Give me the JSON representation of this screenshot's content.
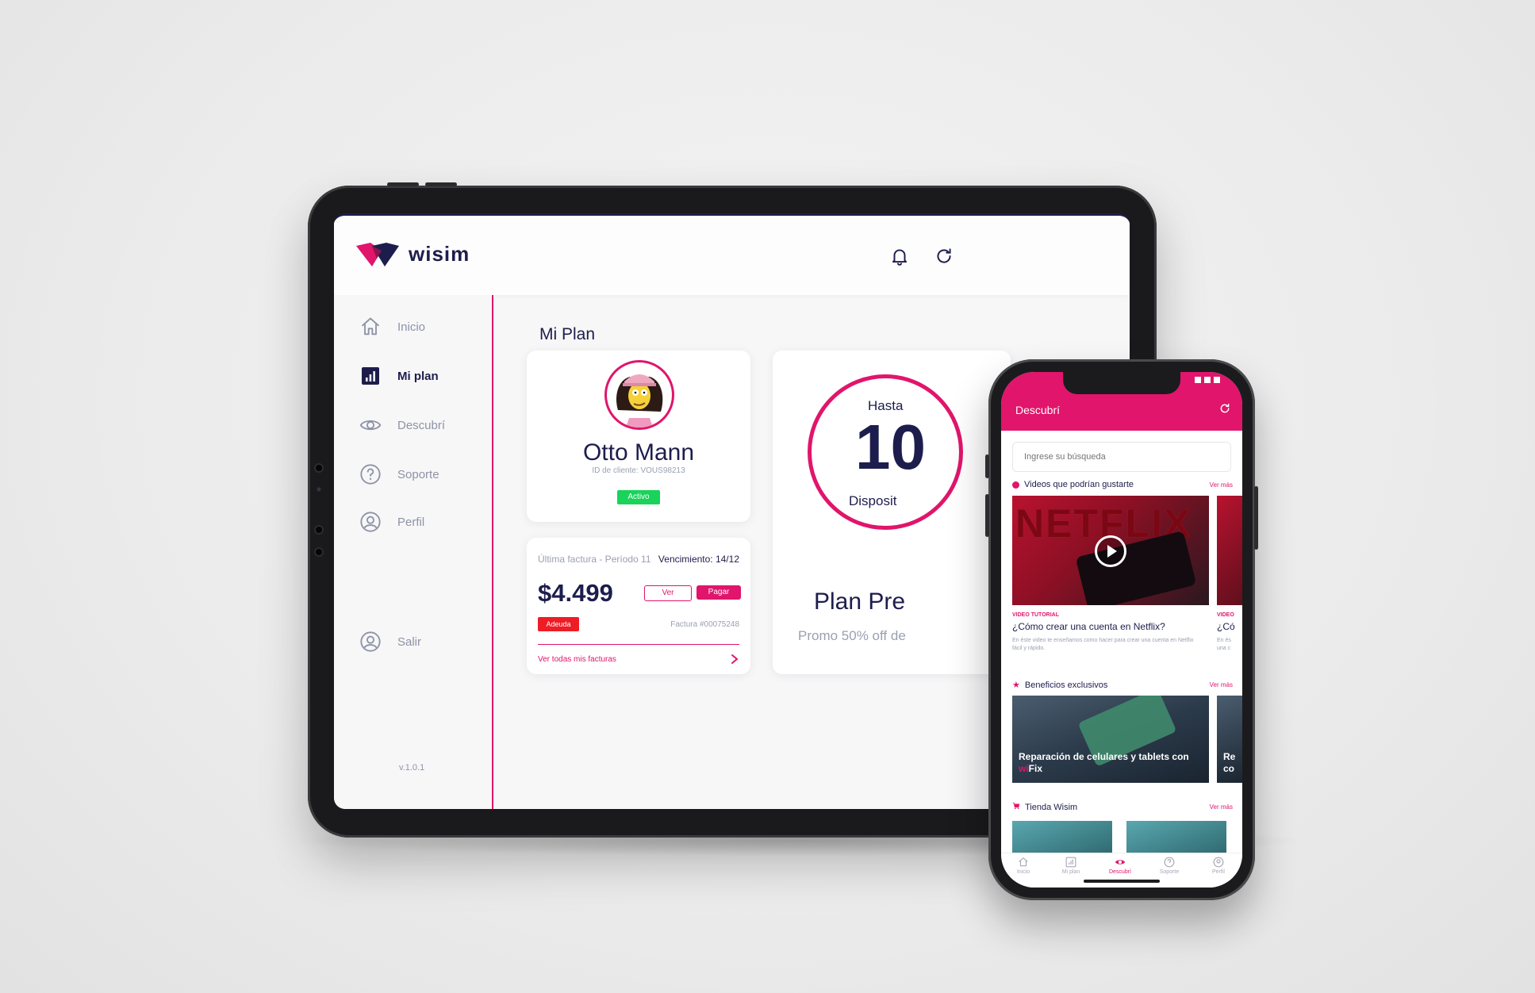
{
  "brand": {
    "name": "wisim",
    "accent": "#e0156b",
    "navy": "#1d1d4d"
  },
  "tablet": {
    "header": {
      "icons": [
        "bell-icon",
        "refresh-icon"
      ]
    },
    "sidebar": {
      "items": [
        {
          "label": "Inicio",
          "icon": "home-icon"
        },
        {
          "label": "Mi plan",
          "icon": "bar-chart-icon"
        },
        {
          "label": "Descubrí",
          "icon": "eye-icon"
        },
        {
          "label": "Soporte",
          "icon": "question-icon"
        },
        {
          "label": "Perfil",
          "icon": "user-icon"
        }
      ],
      "logout": "Salir",
      "version": "v.1.0.1"
    },
    "main": {
      "title": "Mi Plan",
      "profile": {
        "name": "Otto Mann",
        "client_id": "ID de cliente: VOUS98213",
        "status": "Activo"
      },
      "bill": {
        "period": "Última factura - Período 11",
        "due": "Vencimiento: 14/12",
        "amount": "$4.499",
        "view_label": "Ver",
        "pay_label": "Pagar",
        "status": "Adeuda",
        "invoice": "Factura #00075248",
        "all_link": "Ver todas mis facturas"
      },
      "plan": {
        "upto": "Hasta",
        "number": "10",
        "devices": "Disposit",
        "name": "Plan Pre",
        "promo": "Promo 50% off de"
      }
    }
  },
  "phone": {
    "title": "Descubrí",
    "search_placeholder": "Ingrese su búsqueda",
    "sections": {
      "videos": {
        "title": "Videos que podrían gustarte",
        "more": "Ver más"
      },
      "benefits": {
        "title": "Beneficios exclusivos",
        "more": "Ver más"
      },
      "shop": {
        "title": "Tienda Wisim",
        "more": "Ver más"
      }
    },
    "video": {
      "thumb_text": "NETFLIX",
      "tag": "VIDEO TUTORIAL",
      "title": "¿Cómo crear una cuenta en Netflix?",
      "desc": "En éste video te enseñamos como hacer para crear una cuenta en Netflix fácil y rápido.",
      "tag2": "VIDEO",
      "title2": "¿Có",
      "desc2": "En és una c"
    },
    "benefit": {
      "title_part1": "Reparación de celulares y tablets con",
      "brand_part1": "wi",
      "brand_part2": "Fix",
      "title2": "Re co"
    },
    "nav": [
      {
        "label": "Inicio",
        "icon": "home-icon"
      },
      {
        "label": "Mi plan",
        "icon": "bar-chart-icon"
      },
      {
        "label": "Descubrí",
        "icon": "eye-icon"
      },
      {
        "label": "Soporte",
        "icon": "question-icon"
      },
      {
        "label": "Perfil",
        "icon": "user-icon"
      }
    ]
  }
}
